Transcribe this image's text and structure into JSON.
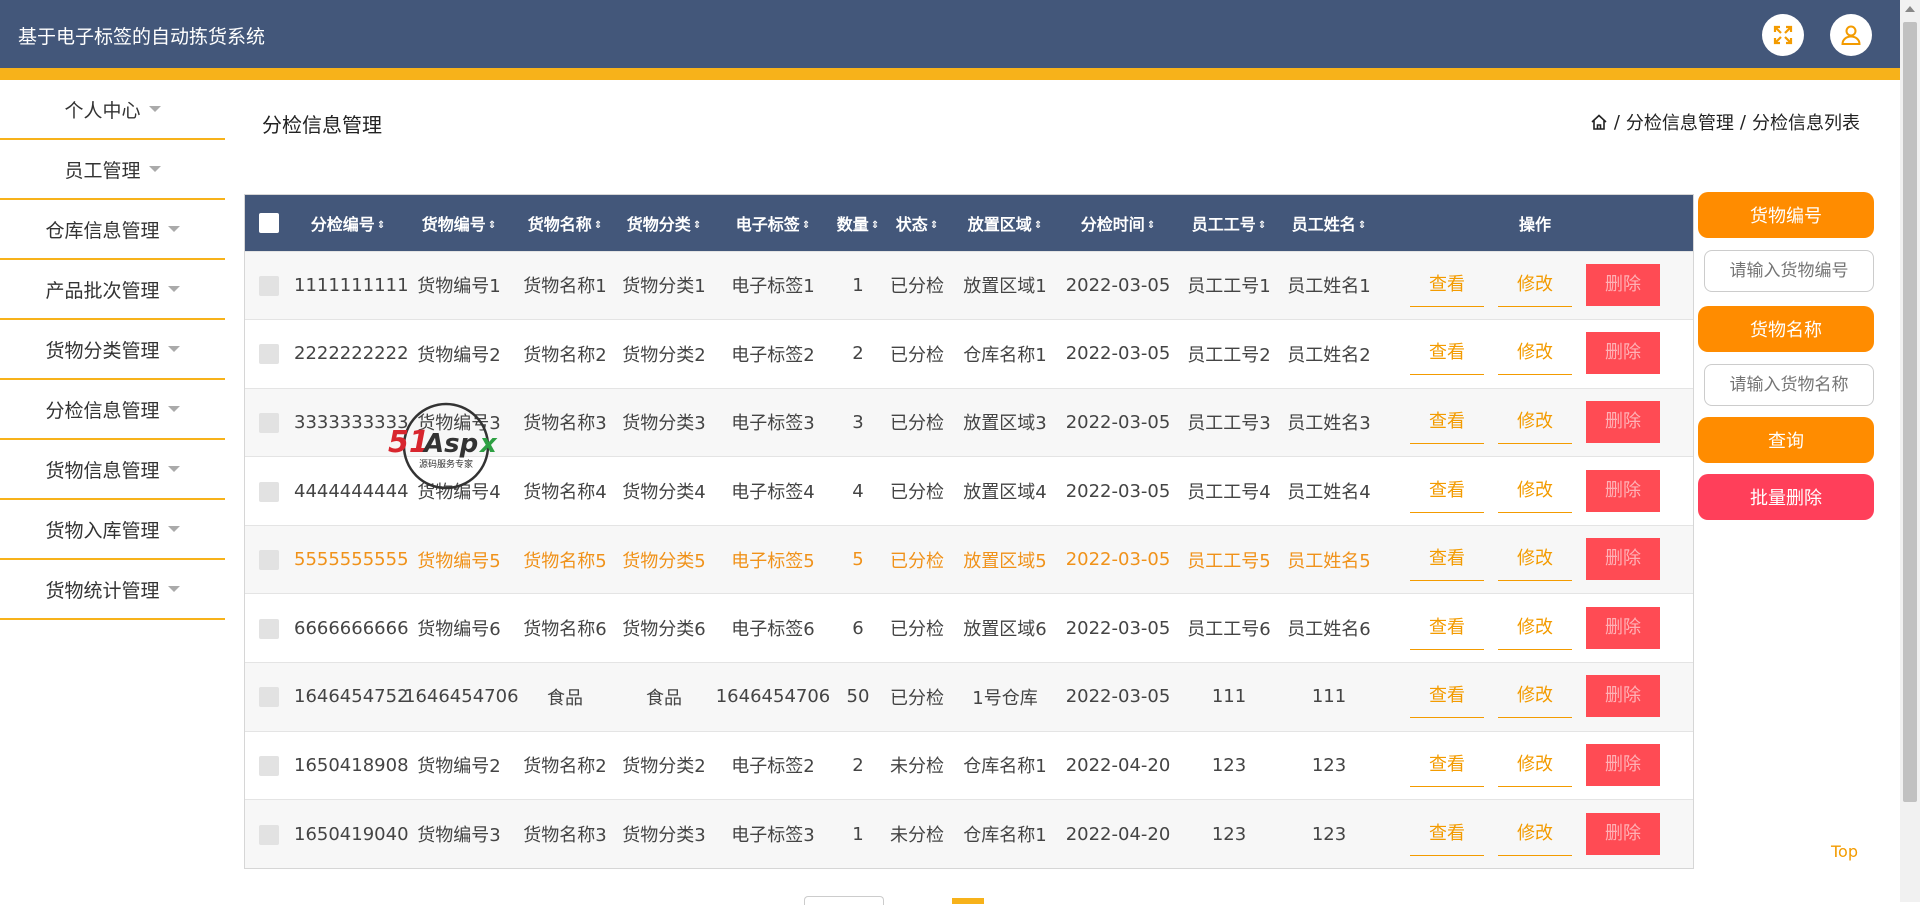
{
  "header": {
    "app_title": "基于电子标签的自动拣货系统",
    "icons": [
      "fullscreen-icon",
      "user-icon"
    ],
    "bg_color": "#43577a",
    "accent_color": "#f7b21a"
  },
  "sidebar": {
    "items": [
      {
        "label": "个人中心"
      },
      {
        "label": "员工管理"
      },
      {
        "label": "仓库信息管理"
      },
      {
        "label": "产品批次管理"
      },
      {
        "label": "货物分类管理"
      },
      {
        "label": "分检信息管理"
      },
      {
        "label": "货物信息管理"
      },
      {
        "label": "货物入库管理"
      },
      {
        "label": "货物统计管理"
      }
    ]
  },
  "main": {
    "title": "分检信息管理",
    "breadcrumb": [
      "分检信息管理",
      "分检信息列表"
    ],
    "breadcrumb_sep": "/"
  },
  "table": {
    "sort_glyph": "⇕",
    "headers": [
      "分检编号",
      "货物编号",
      "货物名称",
      "货物分类",
      "电子标签",
      "数量",
      "状态",
      "放置区域",
      "分检时间",
      "员工工号",
      "员工姓名",
      "操作"
    ],
    "actions": {
      "view": "查看",
      "edit": "修改",
      "delete": "删除"
    },
    "rows": [
      [
        "1111111111",
        "货物编号1",
        "货物名称1",
        "货物分类1",
        "电子标签1",
        "1",
        "已分检",
        "放置区域1",
        "2022-03-05",
        "员工工号1",
        "员工姓名1"
      ],
      [
        "2222222222",
        "货物编号2",
        "货物名称2",
        "货物分类2",
        "电子标签2",
        "2",
        "已分检",
        "仓库名称1",
        "2022-03-05",
        "员工工号2",
        "员工姓名2"
      ],
      [
        "3333333333",
        "货物编号3",
        "货物名称3",
        "货物分类3",
        "电子标签3",
        "3",
        "已分检",
        "放置区域3",
        "2022-03-05",
        "员工工号3",
        "员工姓名3"
      ],
      [
        "4444444444",
        "货物编号4",
        "货物名称4",
        "货物分类4",
        "电子标签4",
        "4",
        "已分检",
        "放置区域4",
        "2022-03-05",
        "员工工号4",
        "员工姓名4"
      ],
      [
        "5555555555",
        "货物编号5",
        "货物名称5",
        "货物分类5",
        "电子标签5",
        "5",
        "已分检",
        "放置区域5",
        "2022-03-05",
        "员工工号5",
        "员工姓名5"
      ],
      [
        "6666666666",
        "货物编号6",
        "货物名称6",
        "货物分类6",
        "电子标签6",
        "6",
        "已分检",
        "放置区域6",
        "2022-03-05",
        "员工工号6",
        "员工姓名6"
      ],
      [
        "1646454752",
        "1646454706",
        "食品",
        "食品",
        "1646454706",
        "50",
        "已分检",
        "1号仓库",
        "2022-03-05",
        "111",
        "111"
      ],
      [
        "1650418908",
        "货物编号2",
        "货物名称2",
        "货物分类2",
        "电子标签2",
        "2",
        "未分检",
        "仓库名称1",
        "2022-04-20",
        "123",
        "123"
      ],
      [
        "1650419040",
        "货物编号3",
        "货物名称3",
        "货物分类3",
        "电子标签3",
        "1",
        "未分检",
        "仓库名称1",
        "2022-04-20",
        "123",
        "123"
      ]
    ],
    "highlighted_row": 4,
    "highlight_color": "#f0921a"
  },
  "search_panel": {
    "goods_no_label": "货物编号",
    "goods_no_placeholder": "请输入货物编号",
    "goods_name_label": "货物名称",
    "goods_name_placeholder": "请输入货物名称",
    "query_button": "查询",
    "batch_delete_button": "批量删除"
  },
  "watermark": {
    "brand": "51Aspx",
    "tagline": "源码服务专家"
  },
  "footer": {
    "top_link": "Top"
  }
}
